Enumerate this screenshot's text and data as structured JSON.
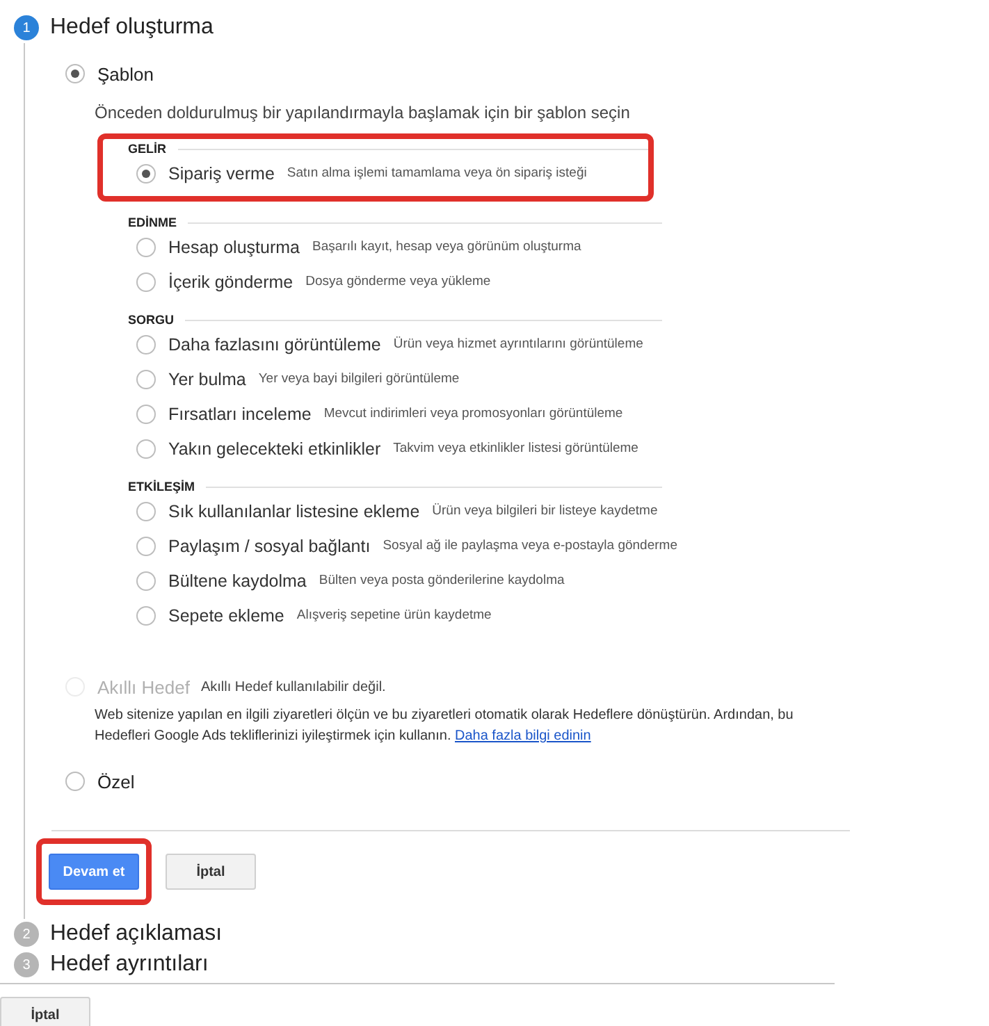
{
  "steps": [
    {
      "number": "1",
      "title": "Hedef oluşturma",
      "active": true
    },
    {
      "number": "2",
      "title": "Hedef açıklaması",
      "active": false
    },
    {
      "number": "3",
      "title": "Hedef ayrıntıları",
      "active": false
    }
  ],
  "options": [
    {
      "kind": "template",
      "label": "Şablon",
      "selected": true,
      "disabled": false,
      "hint": "Önceden doldurulmuş bir yapılandırmayla başlamak için bir şablon seçin",
      "categories": [
        {
          "name": "GELİR",
          "highlighted": true,
          "items": [
            {
              "label": "Sipariş verme",
              "description": "Satın alma işlemi tamamlama veya ön sipariş isteği",
              "selected": true
            }
          ]
        },
        {
          "name": "EDİNME",
          "highlighted": false,
          "items": [
            {
              "label": "Hesap oluşturma",
              "description": "Başarılı kayıt, hesap veya görünüm oluşturma",
              "selected": false
            },
            {
              "label": "İçerik gönderme",
              "description": "Dosya gönderme veya yükleme",
              "selected": false
            }
          ]
        },
        {
          "name": "SORGU",
          "highlighted": false,
          "items": [
            {
              "label": "Daha fazlasını görüntüleme",
              "description": "Ürün veya hizmet ayrıntılarını görüntüleme",
              "selected": false
            },
            {
              "label": "Yer bulma",
              "description": "Yer veya bayi bilgileri görüntüleme",
              "selected": false
            },
            {
              "label": "Fırsatları inceleme",
              "description": "Mevcut indirimleri veya promosyonları görüntüleme",
              "selected": false
            },
            {
              "label": "Yakın gelecekteki etkinlikler",
              "description": "Takvim veya etkinlikler listesi görüntüleme",
              "selected": false
            }
          ]
        },
        {
          "name": "ETKİLEŞİM",
          "highlighted": false,
          "items": [
            {
              "label": "Sık kullanılanlar listesine ekleme",
              "description": "Ürün veya bilgileri bir listeye kaydetme",
              "selected": false
            },
            {
              "label": "Paylaşım / sosyal bağlantı",
              "description": "Sosyal ağ ile paylaşma veya e-postayla gönderme",
              "selected": false
            },
            {
              "label": "Bültene kaydolma",
              "description": "Bülten veya posta gönderilerine kaydolma",
              "selected": false
            },
            {
              "label": "Sepete ekleme",
              "description": "Alışveriş sepetine ürün kaydetme",
              "selected": false
            }
          ]
        }
      ]
    },
    {
      "kind": "smart",
      "label": "Akıllı Hedef",
      "selected": false,
      "disabled": true,
      "status": "Akıllı Hedef kullanılabilir değil.",
      "description": "Web sitenize yapılan en ilgili ziyaretleri ölçün ve bu ziyaretleri otomatik olarak Hedeflere dönüştürün. Ardından, bu Hedefleri Google Ads tekliflerinizi iyileştirmek için kullanın.",
      "link": "Daha fazla bilgi edinin"
    },
    {
      "kind": "custom",
      "label": "Özel",
      "selected": false,
      "disabled": false
    }
  ],
  "actions": [
    {
      "label": "Devam et",
      "kind": "primary",
      "highlighted": true
    },
    {
      "label": "İptal",
      "kind": "secondary",
      "highlighted": false
    }
  ],
  "footer_button": "İptal"
}
